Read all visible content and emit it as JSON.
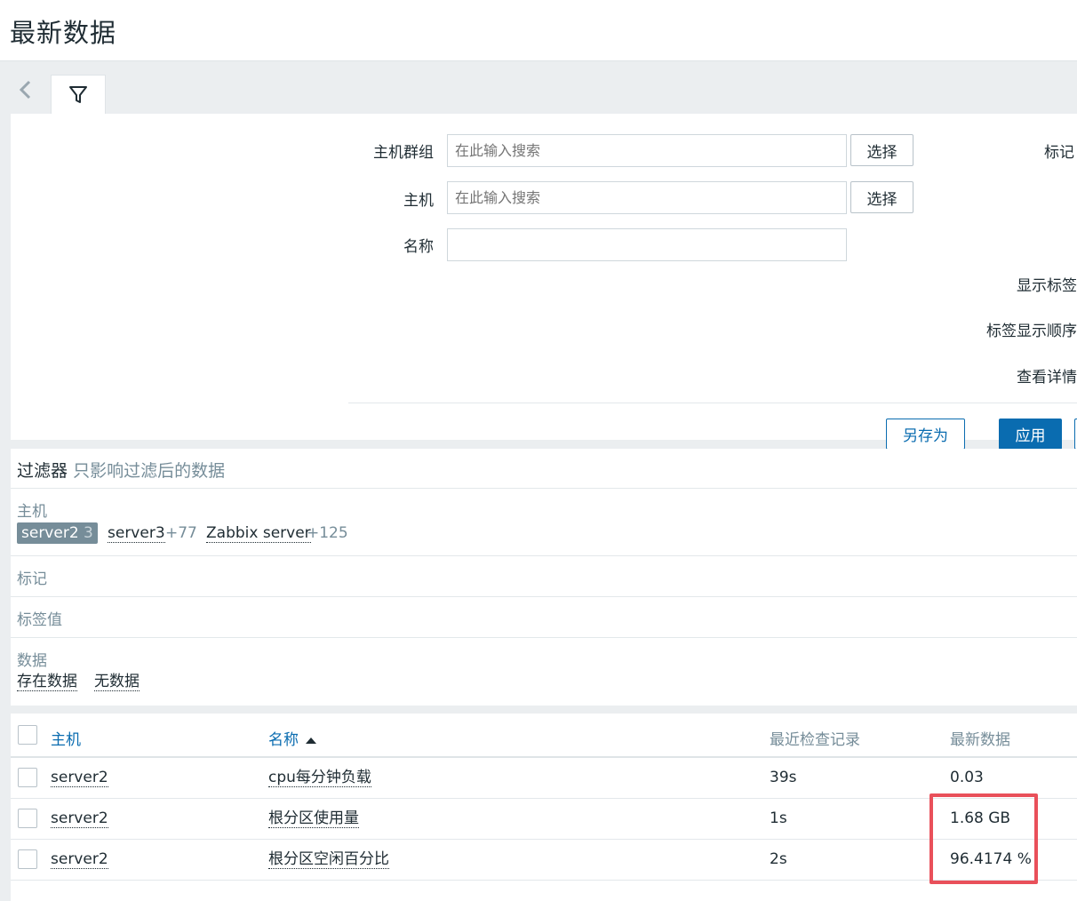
{
  "header": {
    "title": "最新数据"
  },
  "tabs": {
    "back_icon": "chevron-left-icon",
    "filter_icon": "filter-icon"
  },
  "filter": {
    "host_groups_label": "主机群组",
    "host_groups_placeholder": "在此输入搜索",
    "hosts_label": "主机",
    "hosts_placeholder": "在此输入搜索",
    "name_label": "名称",
    "name_value": "",
    "select_label": "选择",
    "tags_label": "标记",
    "show_tags_label": "显示标签",
    "tag_order_label": "标签显示顺序",
    "show_details_label": "查看详情",
    "save_as_label": "另存为",
    "apply_label": "应用"
  },
  "subfilter": {
    "title": "过滤器",
    "hint": "只影响过滤后的数据",
    "hosts_label": "主机",
    "hosts": [
      {
        "name": "server2",
        "count": "3",
        "selected": true
      },
      {
        "name": "server3",
        "count": "+77",
        "selected": false
      },
      {
        "name": "Zabbix server",
        "count": "+125",
        "selected": false
      }
    ],
    "tags_label": "标记",
    "tag_values_label": "标签值",
    "data_label": "数据",
    "data_options": [
      "存在数据",
      "无数据"
    ]
  },
  "table": {
    "columns": {
      "host": "主机",
      "name": "名称",
      "last_check": "最近检查记录",
      "last_value": "最新数据"
    },
    "sort_icon": "sort-asc-icon",
    "rows": [
      {
        "host": "server2",
        "name": "cpu每分钟负载",
        "last_check": "39s",
        "last_value": "0.03"
      },
      {
        "host": "server2",
        "name": "根分区使用量",
        "last_check": "1s",
        "last_value": "1.68 GB"
      },
      {
        "host": "server2",
        "name": "根分区空闲百分比",
        "last_check": "2s",
        "last_value": "96.4174 %"
      }
    ]
  },
  "colors": {
    "accent": "#0a6cb0",
    "highlight": "#e9505a",
    "muted": "#768d99"
  }
}
